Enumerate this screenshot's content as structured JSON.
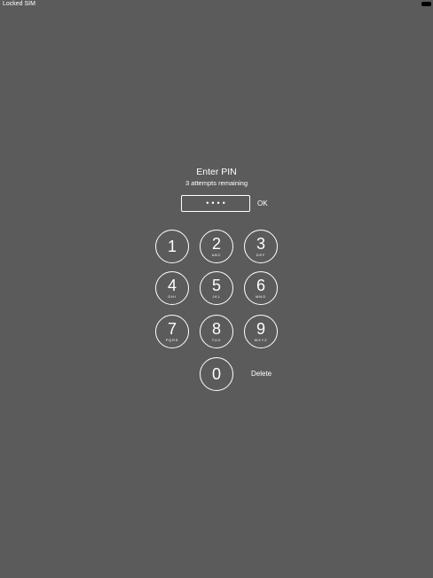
{
  "status_bar": {
    "carrier": "Locked SIM"
  },
  "prompt": {
    "title": "Enter PIN",
    "subtitle": "3 attempts remaining"
  },
  "pin_field": {
    "value": "••••"
  },
  "ok_label": "OK",
  "delete_label": "Delete",
  "keypad": [
    {
      "digit": "1",
      "letters": ""
    },
    {
      "digit": "2",
      "letters": "ABC"
    },
    {
      "digit": "3",
      "letters": "DEF"
    },
    {
      "digit": "4",
      "letters": "GHI"
    },
    {
      "digit": "5",
      "letters": "JKL"
    },
    {
      "digit": "6",
      "letters": "MNO"
    },
    {
      "digit": "7",
      "letters": "PQRS"
    },
    {
      "digit": "8",
      "letters": "TUV"
    },
    {
      "digit": "9",
      "letters": "WXYZ"
    },
    {
      "digit": "0",
      "letters": ""
    }
  ],
  "colors": {
    "background": "#5b5b5b",
    "foreground": "#ffffff"
  }
}
